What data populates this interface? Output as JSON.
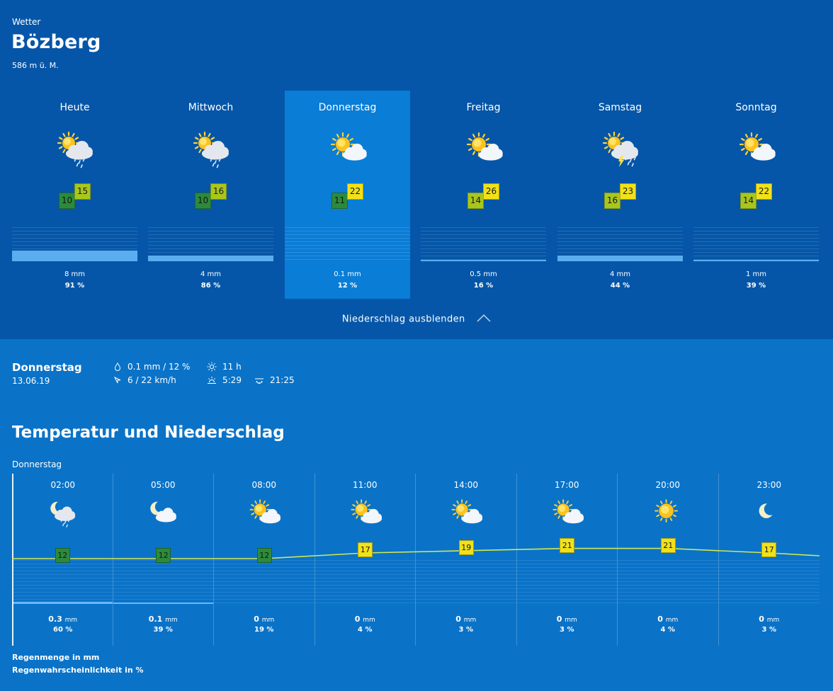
{
  "header": {
    "kicker": "Wetter",
    "city": "Bözberg",
    "altitude": "586 m ü. M."
  },
  "days": [
    {
      "name": "Heute",
      "icon": "sun-cloud-rain-icon",
      "tmin": "10",
      "tmax": "15",
      "precip_mm": "8 mm",
      "precip_pct": "91 %",
      "fill": 0.32
    },
    {
      "name": "Mittwoch",
      "icon": "sun-cloud-rain-icon",
      "tmin": "10",
      "tmax": "16",
      "precip_mm": "4 mm",
      "precip_pct": "86 %",
      "fill": 0.16
    },
    {
      "name": "Donnerstag",
      "icon": "sun-cloud-icon",
      "tmin": "11",
      "tmax": "22",
      "precip_mm": "0.1 mm",
      "precip_pct": "12 %",
      "fill": 0.0
    },
    {
      "name": "Freitag",
      "icon": "sun-cloud-icon",
      "tmin": "14",
      "tmax": "26",
      "precip_mm": "0.5 mm",
      "precip_pct": "16 %",
      "fill": 0.03
    },
    {
      "name": "Samstag",
      "icon": "sun-cloud-thunder-icon",
      "tmin": "16",
      "tmax": "23",
      "precip_mm": "4 mm",
      "precip_pct": "44 %",
      "fill": 0.16
    },
    {
      "name": "Sonntag",
      "icon": "sun-cloud-icon",
      "tmin": "14",
      "tmax": "22",
      "precip_mm": "1 mm",
      "precip_pct": "39 %",
      "fill": 0.05
    }
  ],
  "hide_precip_label": "Niederschlag ausblenden",
  "detail": {
    "day": "Donnerstag",
    "date": "13.06.19",
    "precip": "0.1 mm / 12 %",
    "wind": "6 / 22 km/h",
    "sunshine": "11 h",
    "sunrise": "5:29",
    "sunset": "21:25"
  },
  "hourly": {
    "title": "Temperatur und Niederschlag",
    "day": "Donnerstag",
    "items": [
      {
        "time": "02:00",
        "icon": "moon-cloud-rain-icon",
        "temp": "12",
        "mm": "0.3",
        "unit": "mm",
        "pct": "60 %",
        "fill": 0.05
      },
      {
        "time": "05:00",
        "icon": "moon-cloud-icon",
        "temp": "12",
        "mm": "0.1",
        "unit": "mm",
        "pct": "39 %",
        "fill": 0.02
      },
      {
        "time": "08:00",
        "icon": "sun-cloud-icon",
        "temp": "12",
        "mm": "0",
        "unit": "mm",
        "pct": "19 %",
        "fill": 0
      },
      {
        "time": "11:00",
        "icon": "sun-cloud-icon",
        "temp": "17",
        "mm": "0",
        "unit": "mm",
        "pct": "4 %",
        "fill": 0
      },
      {
        "time": "14:00",
        "icon": "sun-cloud-icon",
        "temp": "19",
        "mm": "0",
        "unit": "mm",
        "pct": "3 %",
        "fill": 0
      },
      {
        "time": "17:00",
        "icon": "sun-cloud-icon",
        "temp": "21",
        "mm": "0",
        "unit": "mm",
        "pct": "3 %",
        "fill": 0
      },
      {
        "time": "20:00",
        "icon": "sun-icon",
        "temp": "21",
        "mm": "0",
        "unit": "mm",
        "pct": "4 %",
        "fill": 0
      },
      {
        "time": "23:00",
        "icon": "moon-icon",
        "temp": "17",
        "mm": "0",
        "unit": "mm",
        "pct": "3 %",
        "fill": 0
      }
    ]
  },
  "legend": {
    "mm": "Regenmenge in mm",
    "pct": "Regenwahrscheinlichkeit in %"
  },
  "colors": {
    "top_bg": "#0556a8",
    "page_bg": "#0a73c8",
    "selected_day": "#0a7dd6",
    "temp_cool": "#2d8a3c",
    "temp_mild": "#a9c61c",
    "temp_warm": "#f1e11a",
    "temp_line": "#d2e655",
    "precip_fill": "#5aaef0"
  }
}
